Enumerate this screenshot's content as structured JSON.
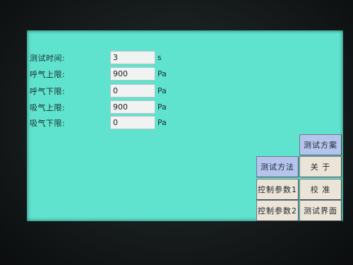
{
  "form": {
    "fields": [
      {
        "label": "测试时间:",
        "value": "3",
        "unit": "s"
      },
      {
        "label": "呼气上限:",
        "value": "900",
        "unit": "Pa"
      },
      {
        "label": "呼气下限:",
        "value": "0",
        "unit": "Pa"
      },
      {
        "label": "吸气上限:",
        "value": "900",
        "unit": "Pa"
      },
      {
        "label": "吸气下限:",
        "value": "0",
        "unit": "Pa"
      }
    ]
  },
  "buttons": {
    "test_plan": "测试方案",
    "test_method": "测试方法",
    "about": "关 于",
    "control_params_1": "控制参数1",
    "calibrate": "校 准",
    "control_params_2": "控制参数2",
    "test_screen": "测试界面"
  },
  "colors": {
    "screen_background": "#5fe3cf",
    "button_active": "#b5c4ec",
    "button_default": "#ece4d6"
  }
}
